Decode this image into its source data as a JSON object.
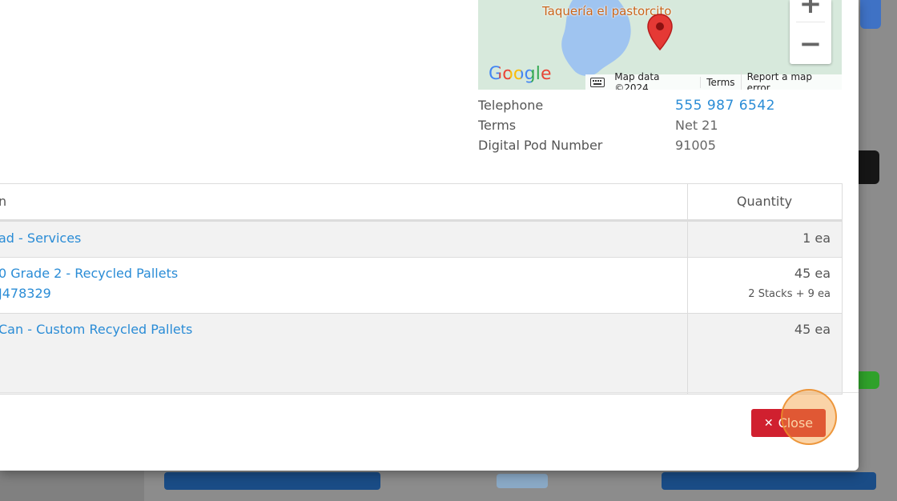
{
  "map": {
    "place_label": "Taquería el pastorcito",
    "zoom_in_label": "+",
    "zoom_out_label": "−",
    "logo_text": "Google",
    "keyboard_icon": "keyboard-icon",
    "attribution": {
      "map_data": "Map data ©2024",
      "terms": "Terms",
      "report": "Report a map error"
    },
    "colors": {
      "land": "#d7e9dc",
      "water": "#9fc4f0",
      "pin": "#e53935"
    }
  },
  "info": {
    "rows": [
      {
        "label": "Telephone",
        "value": "555 987 6542",
        "link": true
      },
      {
        "label": "Terms",
        "value": "Net 21",
        "link": false
      },
      {
        "label": "Digital Pod Number",
        "value": "91005",
        "link": false
      }
    ]
  },
  "table": {
    "headers": {
      "item": "n",
      "quantity": "Quantity"
    },
    "rows": [
      {
        "item_lines": [
          "ad - Services"
        ],
        "quantity": "1 ea",
        "sub": ""
      },
      {
        "item_lines": [
          "0 Grade 2 - Recycled Pallets",
          "J478329"
        ],
        "quantity": "45 ea",
        "sub": "2 Stacks + 9 ea"
      },
      {
        "item_lines": [
          "Can - Custom Recycled Pallets"
        ],
        "quantity": "45 ea",
        "sub": ""
      }
    ]
  },
  "footer": {
    "close_label": "Close",
    "close_icon": "✕",
    "colors": {
      "danger": "#d0202f"
    }
  }
}
